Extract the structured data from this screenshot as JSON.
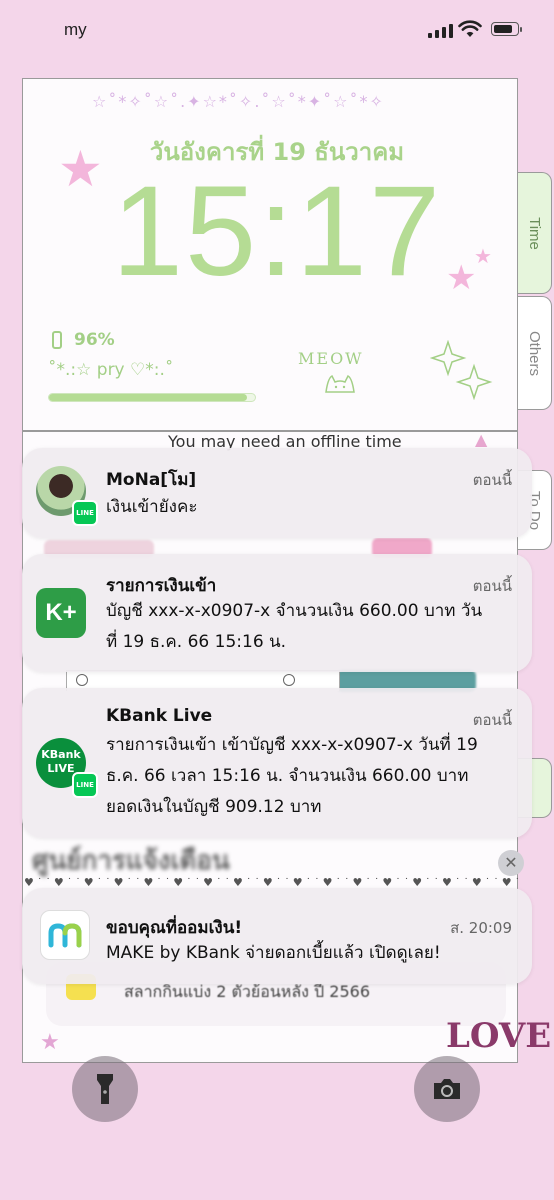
{
  "status_bar": {
    "carrier": "my"
  },
  "widget": {
    "date": "วันอังคารที่ 19 ธันวาคม",
    "time": "15:17",
    "battery_pct": "96%",
    "battery_level": 0.96,
    "caption": "˚*.:☆ pry ♡*:.˚",
    "meow": "MEOW",
    "offline_text": "You may need an offline time",
    "tabs": [
      "Time",
      "Others",
      "To Do"
    ]
  },
  "notifications": [
    {
      "app_icon": "line-avatar-icon",
      "title": "MoNa[โม]",
      "time": "ตอนนี้",
      "body": [
        "เงินเข้ายังคะ"
      ]
    },
    {
      "app_icon": "kplus-icon",
      "title": "รายการเงินเข้า",
      "time": "ตอนนี้",
      "body": [
        "บัญชี xxx-x-x0907-x  จำนวนเงิน 660.00 บาท วัน",
        "ที่ 19 ธ.ค. 66  15:16 น."
      ]
    },
    {
      "app_icon": "kbank-live-icon",
      "title": "KBank Live",
      "time": "ตอนนี้",
      "body": [
        "รายการเงินเข้า เข้าบัญชี xxx-x-x0907-x วันที่ 19",
        "ธ.ค. 66 เวลา 15:16  น. จำนวนเงิน 660.00  บาท",
        "ยอดเงินในบัญชี 909.12  บาท"
      ]
    },
    {
      "app_icon": "make-icon",
      "title": "ขอบคุณที่ออมเงิน!",
      "time": "ส. 20:09",
      "body": [
        "MAKE by KBank จ่ายดอกเบี้ยแล้ว เปิดดูเลย!"
      ]
    }
  ],
  "notification_center": {
    "header": "ศูนย์การแจ้งเตือน"
  },
  "background": {
    "partial_text": "สลากกินแบ่ง 2 ตัวย้อนหลัง ปี 2566",
    "love_text": "LOVE"
  },
  "colors": {
    "accent_green": "#b5dc94",
    "background_pink": "#f4d6ea"
  }
}
